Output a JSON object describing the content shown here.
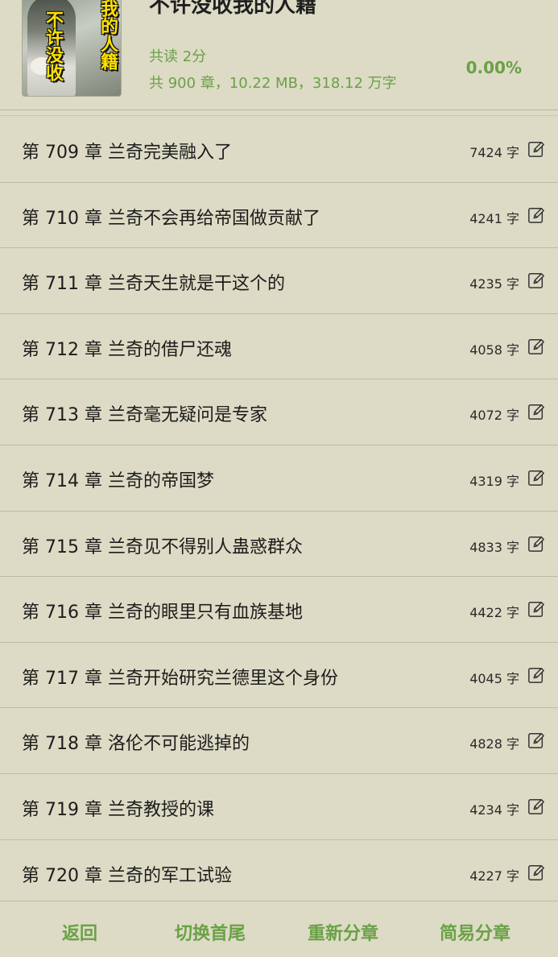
{
  "book": {
    "title": "不许没收我的人籍",
    "cover_text_right": "我的人籍",
    "cover_text_left": "不许没收",
    "read_time": "共读 2分",
    "stats": "共 900 章，10.22 MB，318.12 万字",
    "progress": "0.00%"
  },
  "chapters": [
    {
      "title": "第 709 章 兰奇完美融入了",
      "words": "7424 字"
    },
    {
      "title": "第 710 章 兰奇不会再给帝国做贡献了",
      "words": "4241 字"
    },
    {
      "title": "第 711 章 兰奇天生就是干这个的",
      "words": "4235 字"
    },
    {
      "title": "第 712 章 兰奇的借尸还魂",
      "words": "4058 字"
    },
    {
      "title": "第 713 章 兰奇毫无疑问是专家",
      "words": "4072 字"
    },
    {
      "title": "第 714 章 兰奇的帝国梦",
      "words": "4319 字"
    },
    {
      "title": "第 715 章 兰奇见不得别人蛊惑群众",
      "words": "4833 字"
    },
    {
      "title": "第 716 章 兰奇的眼里只有血族基地",
      "words": "4422 字"
    },
    {
      "title": "第 717 章 兰奇开始研究兰德里这个身份",
      "words": "4045 字"
    },
    {
      "title": "第 718 章 洛伦不可能逃掉的",
      "words": "4828 字"
    },
    {
      "title": "第 719 章 兰奇教授的课",
      "words": "4234 字"
    },
    {
      "title": "第 720 章 兰奇的军工试验",
      "words": "4227 字"
    }
  ],
  "toolbar": {
    "back": "返回",
    "toggle_ends": "切换首尾",
    "resplit": "重新分章",
    "simple_split": "简易分章"
  },
  "colors": {
    "background": "#dddbc5",
    "accent_green": "#6aa146",
    "divider": "#bdbba7"
  },
  "icons": {
    "edit": "pencil-square-icon"
  }
}
